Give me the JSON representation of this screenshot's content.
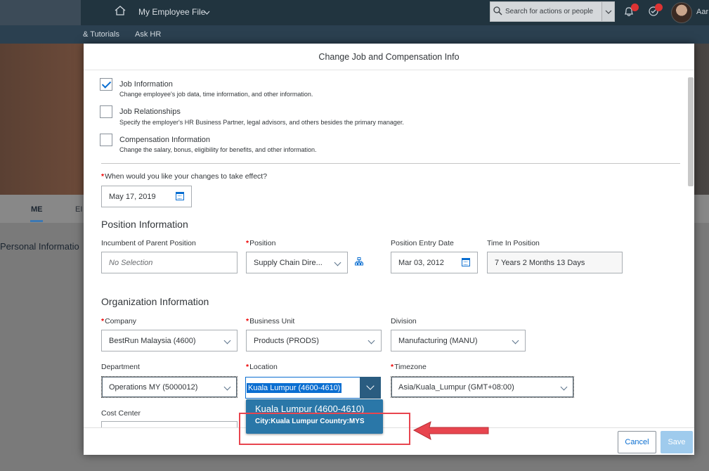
{
  "shell": {
    "title": "My Employee File",
    "search_placeholder": "Search for actions or people",
    "user": "Aar"
  },
  "subnav": {
    "items": [
      "& Tutorials",
      "Ask HR"
    ]
  },
  "background": {
    "tab_me": "ME",
    "tab_em": "EI",
    "personal_info": "Personal Informatio"
  },
  "dialog": {
    "title": "Change Job and Compensation Info",
    "options": [
      {
        "label": "Job Information",
        "desc": "Change employee's job data, time information, and other information.",
        "checked": true
      },
      {
        "label": "Job Relationships",
        "desc": "Specify the employer's HR Business Partner, legal advisors, and others besides the primary manager.",
        "checked": false
      },
      {
        "label": "Compensation Information",
        "desc": "Change the salary, bonus, eligibility for benefits, and other information.",
        "checked": false
      }
    ],
    "effective_label": "When would you like your changes to take effect?",
    "effective_date": "May 17, 2019",
    "position_section": "Position Information",
    "incumbent_label": "Incumbent of Parent Position",
    "incumbent_value": "No Selection",
    "position_label": "Position",
    "position_value": "Supply Chain Dire...",
    "entry_date_label": "Position Entry Date",
    "entry_date_value": "Mar 03, 2012",
    "time_in_position_label": "Time In Position",
    "time_in_position_value": "7 Years 2 Months 13 Days",
    "org_section": "Organization Information",
    "company_label": "Company",
    "company_value": "BestRun Malaysia (4600)",
    "business_unit_label": "Business Unit",
    "business_unit_value": "Products (PRODS)",
    "division_label": "Division",
    "division_value": "Manufacturing (MANU)",
    "department_label": "Department",
    "department_value": "Operations MY (5000012)",
    "location_label": "Location",
    "location_value": "Kuala Lumpur (4600-4610)",
    "timezone_label": "Timezone",
    "timezone_value": "Asia/Kuala_Lumpur (GMT+08:00)",
    "cost_center_label": "Cost Center",
    "suggestion_title": "Kuala Lumpur (4600-4610)",
    "suggestion_detail": "City:Kuala Lumpur Country:MYS",
    "cancel": "Cancel",
    "save": "Save"
  },
  "colors": {
    "accent": "#0a6ed1",
    "suggestion": "#2a77a8",
    "highlight": "#e8454f"
  }
}
